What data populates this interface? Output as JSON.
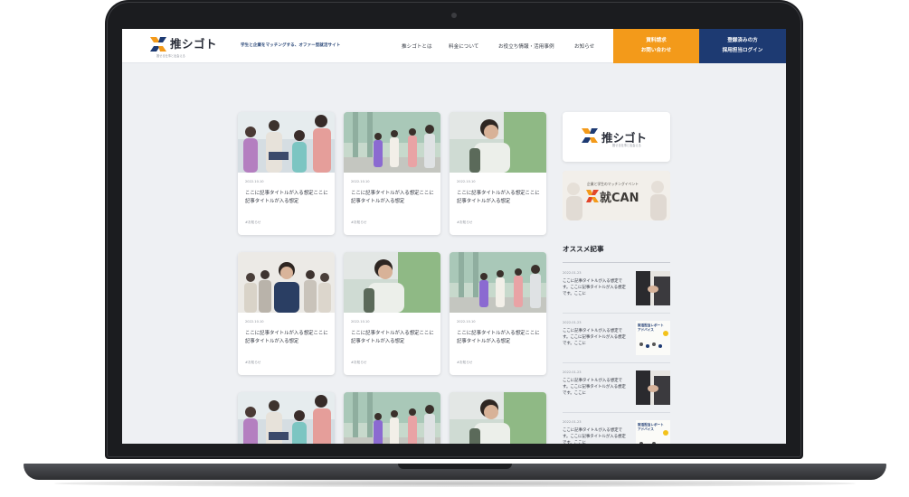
{
  "header": {
    "logo_text": "推シゴト",
    "logo_sub": "推せる仕事と出会える",
    "tagline": "学生と企業をマッチングする、オファー型就活サイト",
    "nav": [
      "推シゴトとは",
      "料金について",
      "お役立ち情報・活用事例",
      "お知らせ"
    ],
    "cta_orange_lines": [
      "資料請求",
      "お問い合わせ"
    ],
    "cta_navy_lines": [
      "登録済みの方",
      "採用担当ログイン"
    ]
  },
  "cards": [
    {
      "date": "2022.10.10",
      "title": "ここに記事タイトルが入る想定ここに記事タイトルが入る想定",
      "tag": "#お知らせ",
      "photo": "group"
    },
    {
      "date": "2022.10.10",
      "title": "ここに記事タイトルが入る想定ここに記事タイトルが入る想定",
      "tag": "#お知らせ",
      "photo": "walk"
    },
    {
      "date": "2022.10.10",
      "title": "ここに記事タイトルが入る想定ここに記事タイトルが入る想定",
      "tag": "#お知らせ",
      "photo": "man"
    },
    {
      "date": "2022.10.10",
      "title": "ここに記事タイトルが入る想定ここに記事タイトルが入る想定",
      "tag": "#お知らせ",
      "photo": "office"
    },
    {
      "date": "2022.10.10",
      "title": "ここに記事タイトルが入る想定ここに記事タイトルが入る想定",
      "tag": "#お知らせ",
      "photo": "man"
    },
    {
      "date": "2022.10.10",
      "title": "ここに記事タイトルが入る想定ここに記事タイトルが入る想定",
      "tag": "#お知らせ",
      "photo": "walk"
    },
    {
      "date": "",
      "title": "",
      "tag": "",
      "photo": "group"
    },
    {
      "date": "",
      "title": "",
      "tag": "",
      "photo": "walk"
    },
    {
      "date": "",
      "title": "",
      "tag": "",
      "photo": "man"
    }
  ],
  "sidebar": {
    "logo_text": "推シゴト",
    "logo_sub": "推せる仕事と出会える",
    "banner_small": "企業と学生のマッチングイベント",
    "banner_main": "就CAN",
    "recommend_heading": "オススメ記事",
    "recommend": [
      {
        "date": "2022.01.23",
        "text": "ここに記事タイトルが入る想定です。ここに記事タイトルが入る想定です。ここに",
        "image": "hands"
      },
      {
        "date": "2022.01.23",
        "text": "ここに記事タイトルが入る想定です。ここに記事タイトルが入る想定です。ここに",
        "image": "infographic",
        "image_lines": [
          "就活担当レポート",
          "アドバイス"
        ]
      },
      {
        "date": "2022.01.23",
        "text": "ここに記事タイトルが入る想定です。ここに記事タイトルが入る想定です。ここに",
        "image": "hands"
      },
      {
        "date": "2022.01.23",
        "text": "ここに記事タイトルが入る想定です。ここに記事タイトルが入る想定です。ここに",
        "image": "infographic",
        "image_lines": [
          "就活担当レポート",
          "アドバイス"
        ]
      }
    ]
  },
  "colors": {
    "orange": "#f39a1a",
    "navy": "#1d3a72",
    "page_bg": "#eef0f3"
  }
}
